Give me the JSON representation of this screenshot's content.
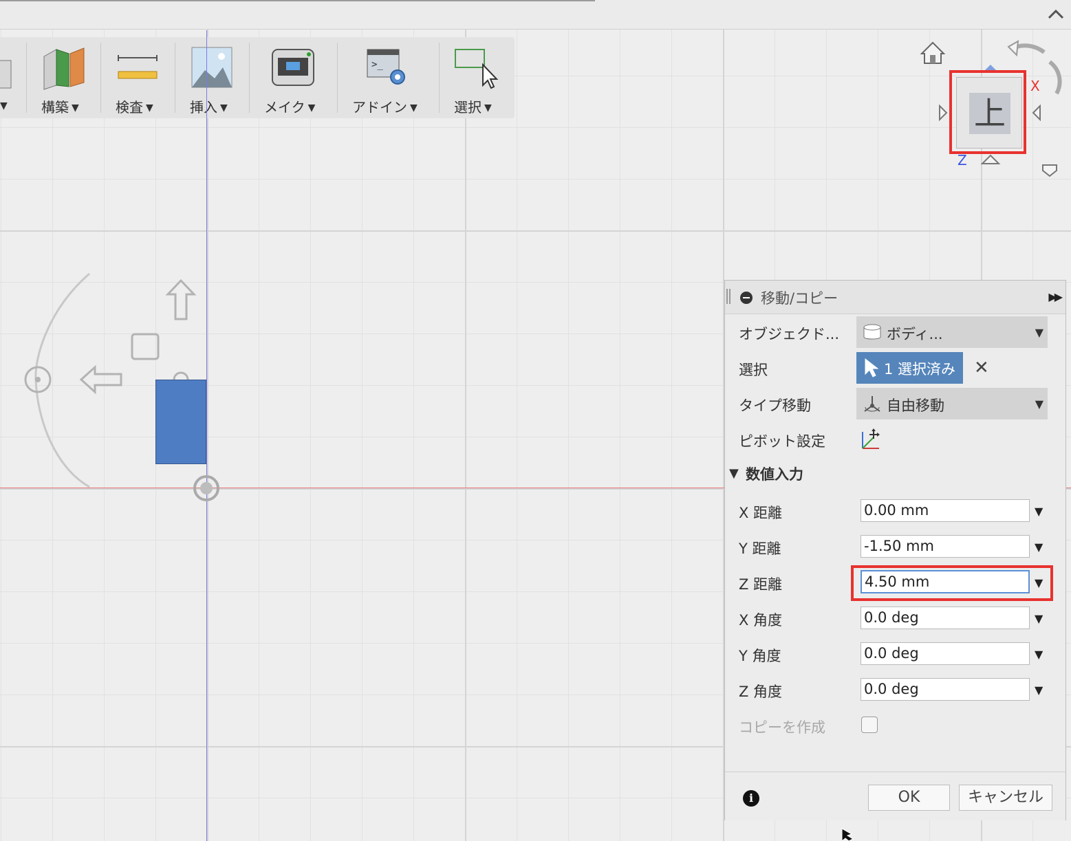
{
  "toolbar": {
    "items": [
      {
        "label": "構築",
        "icon": "construct-icon"
      },
      {
        "label": "検査",
        "icon": "inspect-icon"
      },
      {
        "label": "挿入",
        "icon": "insert-icon"
      },
      {
        "label": "メイク",
        "icon": "make-icon"
      },
      {
        "label": "アドイン",
        "icon": "addin-icon"
      },
      {
        "label": "選択",
        "icon": "select-icon"
      }
    ]
  },
  "viewcube": {
    "face_label": "上",
    "axis_x": "X",
    "axis_z": "Z"
  },
  "dialog": {
    "title": "移動/コピー",
    "object_label": "オブジェクド...",
    "object_value": "ボディ...",
    "select_label": "選択",
    "select_value": "1 選択済み",
    "move_type_label": "タイプ移動",
    "move_type_value": "自由移動",
    "pivot_label": "ピボット設定",
    "numeric_section": "数値入力",
    "fields": [
      {
        "label": "X 距離",
        "value": "0.00 mm"
      },
      {
        "label": "Y 距離",
        "value": "-1.50 mm"
      },
      {
        "label": "Z 距離",
        "value": "4.50 mm"
      },
      {
        "label": "X 角度",
        "value": "0.0 deg"
      },
      {
        "label": "Y 角度",
        "value": "0.0 deg"
      },
      {
        "label": "Z 角度",
        "value": "0.0 deg"
      }
    ],
    "create_copy_label": "コピーを作成",
    "create_copy_checked": false,
    "ok_label": "OK",
    "cancel_label": "キャンセル"
  },
  "colors": {
    "highlight": "#e8322f",
    "body": "#4f7dc4",
    "selection_button": "#5585bb",
    "axis_x_line": "#e87a7a",
    "axis_y_line": "#7a7ae8"
  }
}
